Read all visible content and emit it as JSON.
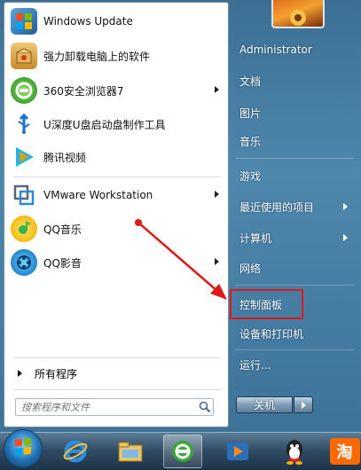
{
  "programs": [
    {
      "label": "Windows Update",
      "icon": "windows-update-icon",
      "has_submenu": false
    },
    {
      "label": "强力卸载电脑上的软件",
      "icon": "uninstaller-box-icon",
      "has_submenu": false
    },
    {
      "label": "360安全浏览器7",
      "icon": "360-browser-icon",
      "has_submenu": true
    },
    {
      "label": "U深度U盘启动盘制作工具",
      "icon": "usb-tool-icon",
      "has_submenu": false
    },
    {
      "label": "腾讯视频",
      "icon": "tencent-video-icon",
      "has_submenu": false
    },
    {
      "label": "VMware Workstation",
      "icon": "vmware-icon",
      "has_submenu": true
    },
    {
      "label": "QQ音乐",
      "icon": "qq-music-icon",
      "has_submenu": false
    },
    {
      "label": "QQ影音",
      "icon": "qq-player-icon",
      "has_submenu": true
    }
  ],
  "all_programs": "所有程序",
  "search": {
    "placeholder": "搜索程序和文件"
  },
  "right": {
    "user": "Administrator",
    "items": [
      {
        "label": "文档",
        "has_submenu": false
      },
      {
        "label": "图片",
        "has_submenu": false
      },
      {
        "label": "音乐",
        "has_submenu": false
      },
      {
        "label": "游戏",
        "has_submenu": false
      },
      {
        "label": "最近使用的项目",
        "has_submenu": true
      },
      {
        "label": "计算机",
        "has_submenu": true
      },
      {
        "label": "网络",
        "has_submenu": false
      },
      {
        "label": "控制面板",
        "has_submenu": false,
        "highlighted": true
      },
      {
        "label": "设备和打印机",
        "has_submenu": false
      },
      {
        "label": "运行...",
        "has_submenu": false
      }
    ]
  },
  "shutdown": {
    "label": "关机"
  },
  "taskbar": {
    "items": [
      "start-orb",
      "internet-explorer-icon",
      "file-explorer-icon",
      "360-browser-icon",
      "tencent-video-icon",
      "qq-icon",
      "taobao-icon"
    ],
    "taobao_text": "淘"
  },
  "annotation": {
    "highlight_color": "#e01818",
    "arrow_color": "#e01818"
  }
}
